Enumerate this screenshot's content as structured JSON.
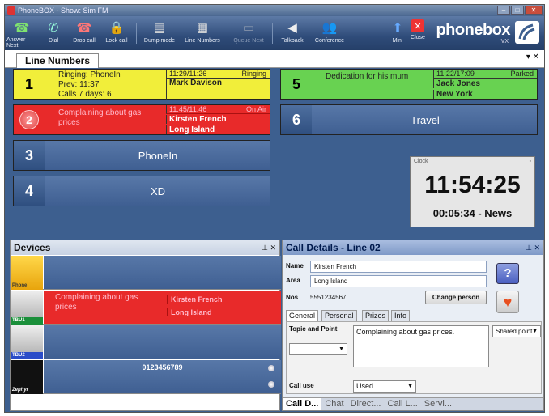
{
  "window": {
    "title": "PhoneBOX - Show: Sim FM"
  },
  "toolbar": {
    "items": [
      {
        "label": "Answer Next",
        "icon": "answer-icon"
      },
      {
        "label": "Dial",
        "icon": "dial-icon"
      },
      {
        "label": "Drop call",
        "icon": "drop-call-icon"
      },
      {
        "label": "Lock call",
        "icon": "lock-icon"
      },
      {
        "label": "Dump mode",
        "icon": "dump-icon"
      },
      {
        "label": "Line Numbers",
        "icon": "line-numbers-icon"
      },
      {
        "label": "Queue Next",
        "icon": "queue-icon"
      },
      {
        "label": "Talkback",
        "icon": "talkback-icon"
      },
      {
        "label": "Conference",
        "icon": "conference-icon"
      },
      {
        "label": "Mini",
        "icon": "mini-icon"
      },
      {
        "label": "Close",
        "icon": "close-icon"
      }
    ],
    "brand": "phonebox",
    "brand_sub": "VX"
  },
  "tab": {
    "label": "Line Numbers"
  },
  "lines": {
    "l1": {
      "num": "1",
      "status": "Ringing: PhoneIn",
      "prev": "Prev: 11:37",
      "calls": "Calls 7 days: 6",
      "time": "11:29/11:26",
      "state": "Ringing",
      "name": "Mark Davison"
    },
    "l2": {
      "num": "2",
      "topic": "Complaining about gas prices",
      "time": "11:45/11:46",
      "state": "On Air",
      "name": "Kirsten French",
      "area": "Long Island"
    },
    "l3": {
      "num": "3",
      "label": "PhoneIn"
    },
    "l4": {
      "num": "4",
      "label": "XD"
    },
    "l5": {
      "num": "5",
      "topic": "Dedication for his mum",
      "time": "11:22/17:09",
      "state": "Parked",
      "name": "Jack Jones",
      "area": "New York"
    },
    "l6": {
      "num": "6",
      "label": "Travel"
    }
  },
  "clock": {
    "caption": "Clock",
    "time": "11:54:25",
    "sub": "00:05:34 - News"
  },
  "devices": {
    "title": "Devices",
    "items": [
      {
        "tag": "Phone"
      },
      {
        "tag": "TBU1",
        "topic": "Complaining about gas prices",
        "name": "Kirsten French",
        "area": "Long Island"
      },
      {
        "tag": "TBU2"
      },
      {
        "tag": "Zephyr",
        "number": "0123456789"
      }
    ]
  },
  "details": {
    "title": "Call Details - Line 02",
    "name_label": "Name",
    "name_value": "Kirsten French",
    "area_label": "Area",
    "area_value": "Long Island",
    "nos_label": "Nos",
    "nos_value": "5551234567",
    "change_person": "Change person",
    "tabs": [
      "General",
      "Personal",
      "Prizes",
      "Info"
    ],
    "topic_label": "Topic and Point",
    "topic_text": "Complaining about gas prices.",
    "shared_point": "Shared point",
    "calluse_label": "Call use",
    "calluse_value": "Used",
    "bottom_tabs": [
      "Call D...",
      "Chat",
      "Direct...",
      "Call L...",
      "Servi..."
    ]
  },
  "colors": {
    "ringing": "#f1ee3a",
    "on_air": "#e82a2a",
    "parked": "#68d251",
    "idle": "#4a6a9c"
  }
}
